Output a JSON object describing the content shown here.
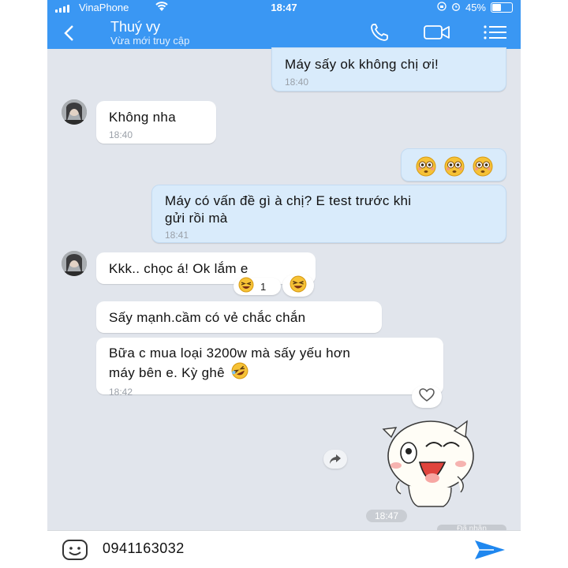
{
  "status": {
    "carrier": "VinaPhone",
    "time": "18:47",
    "battery": "45%",
    "battery_level": 0.45
  },
  "header": {
    "name": "Thuý vy",
    "status": "Vừa mới truy cập",
    "icons": [
      "back-icon",
      "phone-icon",
      "video-camera-icon",
      "menu-icon"
    ]
  },
  "messages": [
    {
      "dir": "out",
      "text": "Máy sấy ok không chị ơi!",
      "time": "18:40"
    },
    {
      "dir": "in",
      "text": "Không nha",
      "time": "18:40"
    },
    {
      "dir": "out",
      "text": "",
      "emojis": [
        "flushed-face",
        "flushed-face",
        "flushed-face"
      ]
    },
    {
      "dir": "out",
      "line1": "Máy có vấn đề gì à chị? E test trước khi",
      "line2": "gửi rồi mà",
      "time": "18:41"
    },
    {
      "dir": "in",
      "text": "Kkk..  chọc á! Ok lắm e",
      "reaction_count": "1",
      "reaction": "laughing-face"
    },
    {
      "dir": "in",
      "text": "Sấy mạnh.cầm có vẻ chắc chắn"
    },
    {
      "dir": "in",
      "line1": "Bữa c mua loại 3200w mà sấy yếu hơn",
      "line2": "máy bên e. Kỳ ghê",
      "time": "18:42"
    }
  ],
  "sticker_time": "18:47",
  "seen_label": "Đã nhận",
  "input": {
    "value": "0941163032"
  },
  "colors": {
    "header": "#3a97f3",
    "out_bubble": "#d9ebfb",
    "in_bubble": "#ffffff",
    "background": "#e1e5ec"
  }
}
